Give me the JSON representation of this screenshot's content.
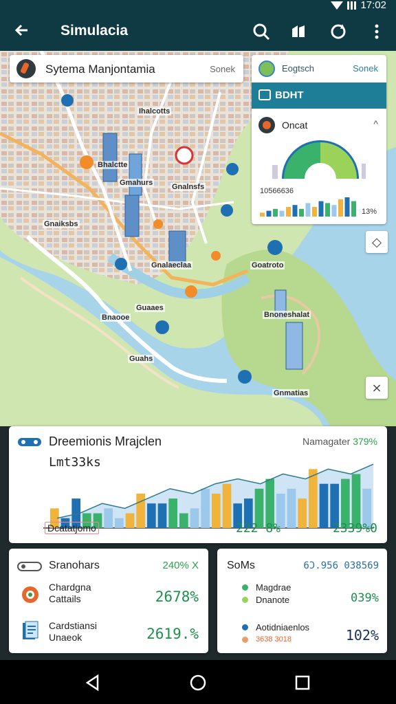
{
  "status": {
    "time": "17:02"
  },
  "appbar": {
    "title": "Simulacia"
  },
  "search": {
    "query": "Sytema Manjontamia",
    "hint": "Sonek"
  },
  "stats_card": {
    "header_label": "Eogtsch",
    "header_action": "Sonek",
    "band_title": "BDHT",
    "section_title": "Oncat",
    "value_label": "10566636",
    "value_pct": "13%"
  },
  "map_labels": [
    "Ihalcotts",
    "Bhalctte",
    "Gmahurs",
    "Gnalnsfs",
    "Gnaiksbs",
    "Gnalaeclaa",
    "Goatroto",
    "Guaaes",
    "Bnaooe",
    "Guahs",
    "Bnoneshalat",
    "Gnmatias"
  ],
  "main_panel": {
    "title": "Dreemionis Mrajclen",
    "subtitle": "Lmt33ks",
    "right_label": "Namagater",
    "right_value": "379%",
    "legend": "Dcatatjomo",
    "value_a": "222 8%",
    "value_b": "2339%0"
  },
  "left_panel": {
    "title": "Sranohars",
    "value": "240% X",
    "rows": [
      {
        "title": "Chardgna",
        "subtitle": "Cattails",
        "value": "2678%"
      },
      {
        "title": "Cardstiansi",
        "subtitle": "Unaeok",
        "value": "2619.%"
      }
    ]
  },
  "right_panel": {
    "title": "SoMs",
    "value": "6Ɔ.956 038569",
    "rows": [
      {
        "title": "Magdrae",
        "subtitle": "Dnanote",
        "value": "039%"
      },
      {
        "title": "Aotidniaenlos",
        "subtitle": "3638 3018",
        "value": "102%"
      }
    ]
  },
  "chart_data": {
    "type": "bar",
    "series": [
      {
        "values": [
          4,
          6,
          3,
          2,
          7,
          5,
          3,
          8,
          9,
          6,
          10,
          8,
          12,
          9,
          11
        ]
      },
      {
        "values": [
          2,
          3,
          4,
          3,
          5,
          6,
          4,
          7,
          5,
          8,
          7,
          6,
          9,
          10,
          8
        ]
      }
    ],
    "area_values": [
      2,
      3,
      5,
      4,
      6,
      8,
      7,
      9,
      10,
      9,
      11,
      10,
      12,
      11,
      13
    ]
  },
  "colors": {
    "appbar": "#0f3a44",
    "teal": "#1f7e97",
    "green": "#1e8f4d",
    "water": "#a8d4ea"
  }
}
